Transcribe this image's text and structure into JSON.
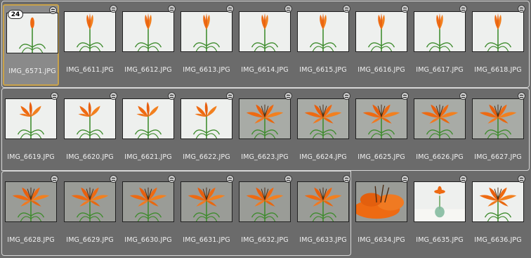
{
  "stack_count": "24",
  "colors": {
    "background": "#6b6b6b",
    "selection": "#c9a24a",
    "petal": "#ee6a12",
    "stem": "#3d8b2c"
  },
  "rows": [
    {
      "items": [
        {
          "filename": "IMG_6571.JPG",
          "selected": true,
          "bloom": "bud",
          "backdrop": "light"
        },
        {
          "filename": "IMG_6611.JPG",
          "bloom": "closed",
          "backdrop": "light"
        },
        {
          "filename": "IMG_6612.JPG",
          "bloom": "closed",
          "backdrop": "light"
        },
        {
          "filename": "IMG_6613.JPG",
          "bloom": "closed",
          "backdrop": "light"
        },
        {
          "filename": "IMG_6614.JPG",
          "bloom": "closed",
          "backdrop": "light"
        },
        {
          "filename": "IMG_6615.JPG",
          "bloom": "closed",
          "backdrop": "light"
        },
        {
          "filename": "IMG_6616.JPG",
          "bloom": "closed",
          "backdrop": "light"
        },
        {
          "filename": "IMG_6617.JPG",
          "bloom": "closed",
          "backdrop": "light"
        },
        {
          "filename": "IMG_6618.JPG",
          "bloom": "closed",
          "backdrop": "light"
        }
      ]
    },
    {
      "items": [
        {
          "filename": "IMG_6619.JPG",
          "bloom": "opening",
          "backdrop": "light"
        },
        {
          "filename": "IMG_6620.JPG",
          "bloom": "opening",
          "backdrop": "light"
        },
        {
          "filename": "IMG_6621.JPG",
          "bloom": "opening",
          "backdrop": "light"
        },
        {
          "filename": "IMG_6622.JPG",
          "bloom": "opening",
          "backdrop": "light"
        },
        {
          "filename": "IMG_6623.JPG",
          "bloom": "open",
          "backdrop": "mid"
        },
        {
          "filename": "IMG_6624.JPG",
          "bloom": "open",
          "backdrop": "mid"
        },
        {
          "filename": "IMG_6625.JPG",
          "bloom": "open",
          "backdrop": "mid"
        },
        {
          "filename": "IMG_6626.JPG",
          "bloom": "open",
          "backdrop": "mid"
        },
        {
          "filename": "IMG_6627.JPG",
          "bloom": "open",
          "backdrop": "mid"
        }
      ]
    },
    {
      "items": [
        {
          "filename": "IMG_6628.JPG",
          "bloom": "open",
          "backdrop": "dark"
        },
        {
          "filename": "IMG_6629.JPG",
          "bloom": "open",
          "backdrop": "dark"
        },
        {
          "filename": "IMG_6630.JPG",
          "bloom": "open",
          "backdrop": "dark"
        },
        {
          "filename": "IMG_6631.JPG",
          "bloom": "open",
          "backdrop": "dark"
        },
        {
          "filename": "IMG_6632.JPG",
          "bloom": "open",
          "backdrop": "dark"
        },
        {
          "filename": "IMG_6633.JPG",
          "bloom": "open",
          "backdrop": "dark"
        },
        {
          "filename": "IMG_6634.JPG",
          "bloom": "closeup",
          "backdrop": "dark"
        },
        {
          "filename": "IMG_6635.JPG",
          "bloom": "vase",
          "backdrop": "light"
        },
        {
          "filename": "IMG_6636.JPG",
          "bloom": "open",
          "backdrop": "light"
        }
      ]
    }
  ]
}
